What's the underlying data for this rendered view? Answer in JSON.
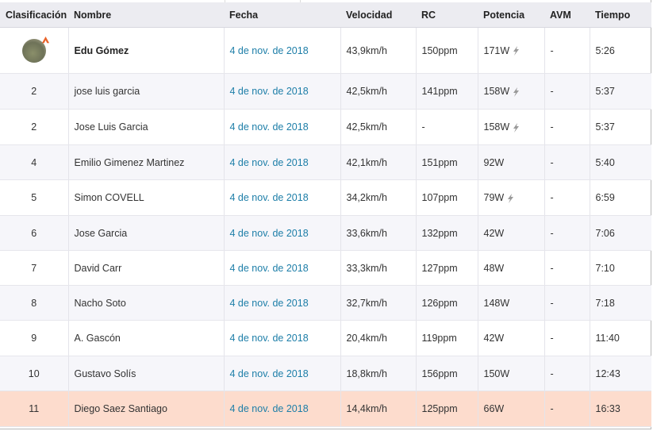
{
  "columns": [
    "Clasificación",
    "Nombre",
    "Fecha",
    "Velocidad",
    "RC",
    "Potencia",
    "AVM",
    "Tiempo"
  ],
  "rows": [
    {
      "rank": "",
      "avatar": true,
      "name": "Edu Gómez",
      "bold": true,
      "date": "4 de nov. de 2018",
      "speed": "43,9km/h",
      "rc": "150ppm",
      "power": "171W",
      "bolt": true,
      "avm": "-",
      "time": "5:26"
    },
    {
      "rank": "2",
      "name": "jose luis garcia",
      "date": "4 de nov. de 2018",
      "speed": "42,5km/h",
      "rc": "141ppm",
      "power": "158W",
      "bolt": true,
      "avm": "-",
      "time": "5:37"
    },
    {
      "rank": "2",
      "name": "Jose Luis Garcia",
      "date": "4 de nov. de 2018",
      "speed": "42,5km/h",
      "rc": "-",
      "power": "158W",
      "bolt": true,
      "avm": "-",
      "time": "5:37"
    },
    {
      "rank": "4",
      "name": "Emilio Gimenez Martinez",
      "date": "4 de nov. de 2018",
      "speed": "42,1km/h",
      "rc": "151ppm",
      "power": "92W",
      "bolt": false,
      "avm": "-",
      "time": "5:40"
    },
    {
      "rank": "5",
      "name": "Simon COVELL",
      "date": "4 de nov. de 2018",
      "speed": "34,2km/h",
      "rc": "107ppm",
      "power": "79W",
      "bolt": true,
      "avm": "-",
      "time": "6:59"
    },
    {
      "rank": "6",
      "name": "Jose Garcia",
      "date": "4 de nov. de 2018",
      "speed": "33,6km/h",
      "rc": "132ppm",
      "power": "42W",
      "bolt": false,
      "avm": "-",
      "time": "7:06"
    },
    {
      "rank": "7",
      "name": "David Carr",
      "date": "4 de nov. de 2018",
      "speed": "33,3km/h",
      "rc": "127ppm",
      "power": "48W",
      "bolt": false,
      "avm": "-",
      "time": "7:10"
    },
    {
      "rank": "8",
      "name": "Nacho Soto",
      "date": "4 de nov. de 2018",
      "speed": "32,7km/h",
      "rc": "126ppm",
      "power": "148W",
      "bolt": false,
      "avm": "-",
      "time": "7:18"
    },
    {
      "rank": "9",
      "name": "A. Gascón",
      "date": "4 de nov. de 2018",
      "speed": "20,4km/h",
      "rc": "119ppm",
      "power": "42W",
      "bolt": false,
      "avm": "-",
      "time": "11:40"
    },
    {
      "rank": "10",
      "name": "Gustavo Solís",
      "date": "4 de nov. de 2018",
      "speed": "18,8km/h",
      "rc": "156ppm",
      "power": "150W",
      "bolt": false,
      "avm": "-",
      "time": "12:43"
    },
    {
      "rank": "11",
      "name": "Diego Saez Santiago",
      "date": "4 de nov. de 2018",
      "speed": "14,4km/h",
      "rc": "125ppm",
      "power": "66W",
      "bolt": false,
      "avm": "-",
      "time": "16:33",
      "highlight": true
    }
  ],
  "colors": {
    "header_bg": "#ececf1",
    "alt_row_bg": "#f6f6fa",
    "highlight_row_bg": "#fddccd",
    "date_link": "#1d7ea8",
    "badge_orange": "#e8642c"
  },
  "icons": {
    "power_source": "lightning-bolt-icon",
    "avatar_badge": "strava-badge-icon"
  }
}
